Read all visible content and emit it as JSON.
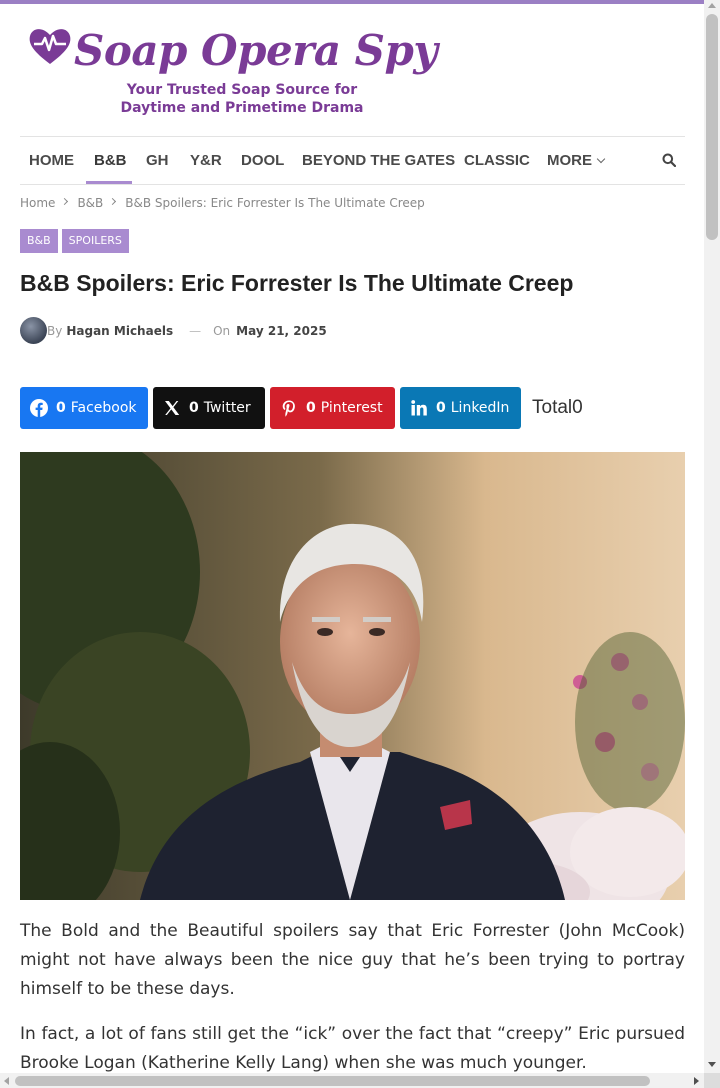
{
  "site": {
    "name": "Soap Opera Spy",
    "tagline_line1": "Your Trusted Soap Source for",
    "tagline_line2": "Daytime and Primetime Drama",
    "brand_color": "#7a3b96",
    "accent_color": "#a98bd0"
  },
  "nav": {
    "items": [
      {
        "label": "HOME"
      },
      {
        "label": "B&B",
        "active": true
      },
      {
        "label": "GH"
      },
      {
        "label": "Y&R"
      },
      {
        "label": "DOOL"
      },
      {
        "label": "BEYOND THE GATES"
      },
      {
        "label": "CLASSIC"
      },
      {
        "label": "MORE"
      }
    ],
    "search_icon": "search-icon"
  },
  "breadcrumb": {
    "items": [
      "Home",
      "B&B",
      "B&B Spoilers: Eric Forrester Is The Ultimate Creep"
    ]
  },
  "categories": [
    "B&B",
    "SPOILERS"
  ],
  "article": {
    "title": "B&B Spoilers: Eric Forrester Is The Ultimate Creep",
    "by_label": "By",
    "author": "Hagan Michaels",
    "on_label": "On",
    "date": "May 21, 2025",
    "paragraphs": [
      "The Bold and the Beautiful spoilers say that Eric Forrester (John McCook) might not have always been the nice guy that he’s been trying to portray himself to be these days.",
      "In fact, a lot of fans still get the “ick” over the fact that “creepy” Eric pursued Brooke Logan (Katherine Kelly Lang) when she was much younger."
    ]
  },
  "share": {
    "buttons": [
      {
        "network": "Facebook",
        "count": "0",
        "color": "#1877f2",
        "icon": "facebook-icon"
      },
      {
        "network": "Twitter",
        "count": "0",
        "color": "#111111",
        "icon": "x-twitter-icon"
      },
      {
        "network": "Pinterest",
        "count": "0",
        "color": "#d21f2b",
        "icon": "pinterest-icon"
      },
      {
        "network": "LinkedIn",
        "count": "0",
        "color": "#0a78b5",
        "icon": "linkedin-icon"
      }
    ],
    "total_label": "Total",
    "total_count": "0"
  }
}
